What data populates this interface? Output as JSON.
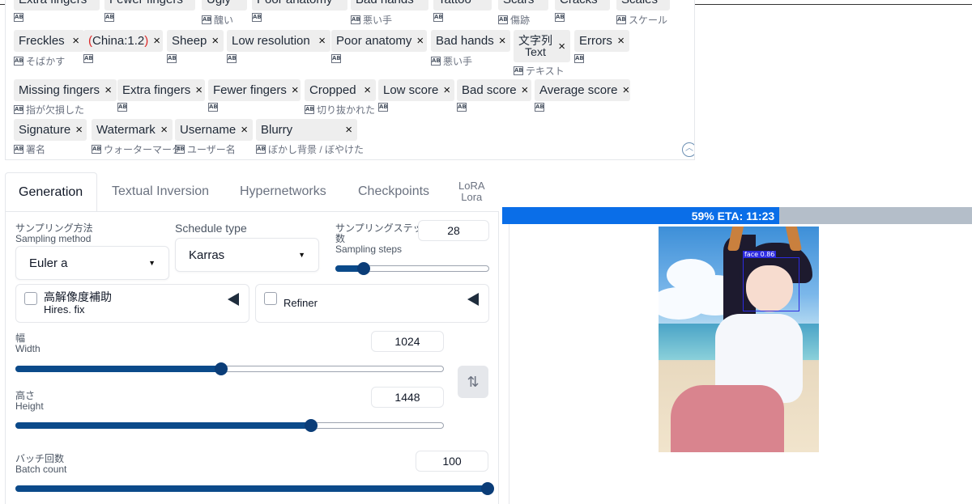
{
  "tags": {
    "top_row": [
      {
        "label": "Extra fingers"
      },
      {
        "label": "Fewer fingers"
      },
      {
        "label": "Ugly",
        "translation": "醜い"
      },
      {
        "label": "Poor anatomy"
      },
      {
        "label": "Bad hands",
        "translation": "悪い手"
      },
      {
        "label": "Tattoo"
      },
      {
        "label": "Scars",
        "translation": "傷跡"
      },
      {
        "label": "Cracks"
      },
      {
        "label": "Scales",
        "translation": "スケール"
      }
    ],
    "row1": [
      {
        "label": "Freckles",
        "translation": "そばかす"
      },
      {
        "label_open": "(",
        "label_mid": "China:1.2",
        "label_close": ")",
        "translation": ""
      },
      {
        "label": "Sheep",
        "translation": ""
      },
      {
        "label": "Low resolution",
        "translation": ""
      },
      {
        "label": "Poor anatomy",
        "translation": ""
      },
      {
        "label": "Bad hands",
        "translation": "悪い手"
      },
      {
        "label_line1": "文字列",
        "label_line2": "Text",
        "translation": "テキスト"
      },
      {
        "label": "Errors",
        "translation": ""
      }
    ],
    "row2": [
      {
        "label": "Missing fingers",
        "translation": "指が欠損した"
      },
      {
        "label": "Extra fingers",
        "translation": ""
      },
      {
        "label": "Fewer fingers",
        "translation": ""
      },
      {
        "label": "Cropped",
        "translation": "切り抜かれた"
      },
      {
        "label": "Low score",
        "translation": ""
      },
      {
        "label": "Bad score",
        "translation": ""
      },
      {
        "label": "Average score",
        "translation": ""
      }
    ],
    "row3": [
      {
        "label": "Signature",
        "translation": "署名"
      },
      {
        "label": "Watermark",
        "translation": "ウォーターマーク"
      },
      {
        "label": "Username",
        "translation": "ユーザー名"
      },
      {
        "label": "Blurry",
        "translation": "ぼかし背景 / ぼやけた"
      }
    ],
    "remove_glyph": "×",
    "translate_badge": "AB"
  },
  "tabs": [
    {
      "label": "Generation"
    },
    {
      "label": "Textual Inversion"
    },
    {
      "label": "Hypernetworks"
    },
    {
      "label": "Checkpoints"
    },
    {
      "label_line1": "LoRA",
      "label_line2": "Lora"
    }
  ],
  "sampling_method": {
    "label_ja": "サンプリング方法",
    "label_en": "Sampling method",
    "value": "Euler a"
  },
  "schedule_type": {
    "label": "Schedule type",
    "value": "Karras"
  },
  "sampling_steps": {
    "label_ja_line1": "サンプリングステップ",
    "label_ja_line2": "数",
    "label_en": "Sampling steps",
    "value": "28",
    "min": 1,
    "max": 150
  },
  "hires_fix": {
    "label_ja": "高解像度補助",
    "label_en": "Hires. fix"
  },
  "refiner": {
    "label": "Refiner"
  },
  "width": {
    "label_ja": "幅",
    "label_en": "Width",
    "value": "1024",
    "fraction": 0.48
  },
  "height": {
    "label_ja": "高さ",
    "label_en": "Height",
    "value": "1448",
    "fraction": 0.69
  },
  "batch_count": {
    "label_ja": "バッチ回数",
    "label_en": "Batch count",
    "value": "100",
    "fraction": 1.0
  },
  "swap_icon": "⇅",
  "progress": {
    "text": "59% ETA: 11:23",
    "percent": 59
  },
  "detection": {
    "label": "face 0.86"
  },
  "colors": {
    "accent": "#0b4a8a",
    "progress": "#0a6ee8",
    "detection_box": "#2d2be0"
  },
  "icons": {
    "collapse": "chevron-up-icon",
    "caret": "caret-down-icon",
    "triangle": "triangle-left-icon"
  }
}
